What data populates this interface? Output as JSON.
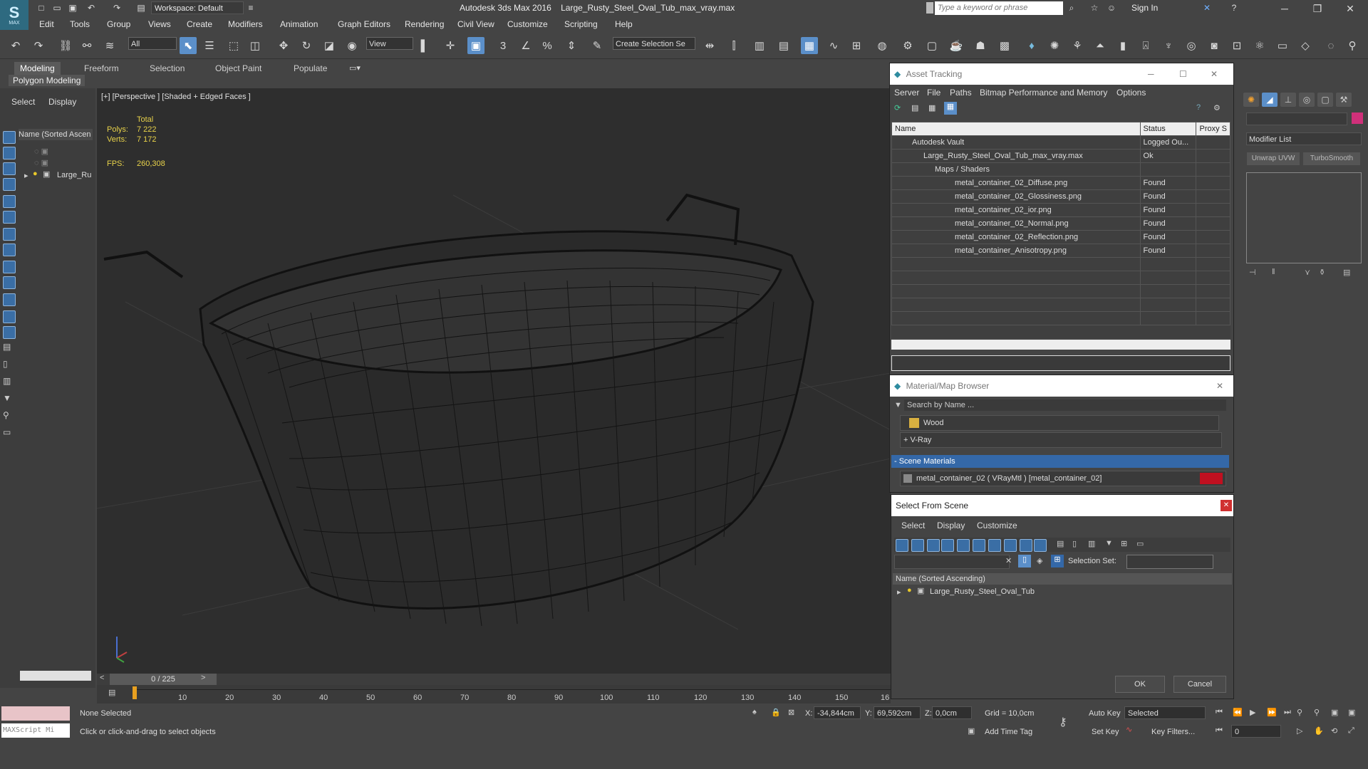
{
  "app": {
    "title": "Autodesk 3ds Max 2016",
    "filename": "Large_Rusty_Steel_Oval_Tub_max_vray.max",
    "workspace": "Workspace: Default",
    "logo": "MAX",
    "search_placeholder": "Type a keyword or phrase",
    "sign_in": "Sign In"
  },
  "menu": [
    "Edit",
    "Tools",
    "Group",
    "Views",
    "Create",
    "Modifiers",
    "Animation",
    "Graph Editors",
    "Rendering",
    "Civil View",
    "Customize",
    "Scripting",
    "Help"
  ],
  "toolbar": {
    "filter_select": "All",
    "view_select": "View",
    "selection_set": "Create Selection Se"
  },
  "ribbon": {
    "tabs": [
      "Modeling",
      "Freeform",
      "Selection",
      "Object Paint",
      "Populate"
    ],
    "sub_label": "Polygon Modeling"
  },
  "scene_explorer": {
    "tabs": [
      "Select",
      "Display"
    ],
    "header": "Name (Sorted Ascen",
    "items": [
      "Large_Ru"
    ]
  },
  "viewport": {
    "label": "[+] [Perspective ] [Shaded + Edged Faces ]",
    "stats": {
      "total_label": "Total",
      "polys_label": "Polys:",
      "polys_value": "7 222",
      "verts_label": "Verts:",
      "verts_value": "7 172",
      "fps_label": "FPS:",
      "fps_value": "260,308"
    }
  },
  "timeline": {
    "frame": "0 / 225",
    "ticks": [
      "10",
      "20",
      "30",
      "40",
      "50",
      "60",
      "70",
      "80",
      "90",
      "100",
      "110",
      "120",
      "130",
      "140",
      "150",
      "16"
    ]
  },
  "status": {
    "maxscript": "MAXScript Mi",
    "selection": "None Selected",
    "prompt": "Click or click-and-drag to select objects",
    "x_label": "X:",
    "x_value": "-34,844cm",
    "y_label": "Y:",
    "y_value": "69,592cm",
    "z_label": "Z:",
    "z_value": "0,0cm",
    "grid": "Grid = 10,0cm",
    "add_time_tag": "Add Time Tag",
    "auto_key": "Auto Key",
    "set_key": "Set Key",
    "key_mode": "Selected",
    "key_filters": "Key Filters...",
    "frame_value": "0"
  },
  "asset_tracking": {
    "title": "Asset Tracking",
    "menu": [
      "Server",
      "File",
      "Paths",
      "Bitmap Performance and Memory",
      "Options"
    ],
    "columns": [
      "Name",
      "Status",
      "Proxy S"
    ],
    "rows": [
      {
        "name": "Autodesk Vault",
        "status": "Logged Ou..."
      },
      {
        "name": "Large_Rusty_Steel_Oval_Tub_max_vray.max",
        "status": "Ok"
      },
      {
        "name": "Maps / Shaders",
        "status": ""
      },
      {
        "name": "metal_container_02_Diffuse.png",
        "status": "Found"
      },
      {
        "name": "metal_container_02_Glossiness.png",
        "status": "Found"
      },
      {
        "name": "metal_container_02_ior.png",
        "status": "Found"
      },
      {
        "name": "metal_container_02_Normal.png",
        "status": "Found"
      },
      {
        "name": "metal_container_02_Reflection.png",
        "status": "Found"
      },
      {
        "name": "metal_container_Anisotropy.png",
        "status": "Found"
      }
    ]
  },
  "material_browser": {
    "title": "Material/Map Browser",
    "search_placeholder": "Search by Name ...",
    "wood": "Wood",
    "vray": "+ V-Ray",
    "scene_materials": "- Scene Materials",
    "material": "metal_container_02 ( VRayMtl ) [metal_container_02]"
  },
  "select_from_scene": {
    "title": "Select From Scene",
    "menu": [
      "Select",
      "Display",
      "Customize"
    ],
    "selection_set_label": "Selection Set:",
    "header": "Name (Sorted Ascending)",
    "item": "Large_Rusty_Steel_Oval_Tub",
    "ok": "OK",
    "cancel": "Cancel"
  },
  "command_panel": {
    "modifier_list": "Modifier List",
    "buttons": [
      "Unwrap UVW",
      "TurboSmooth"
    ]
  }
}
